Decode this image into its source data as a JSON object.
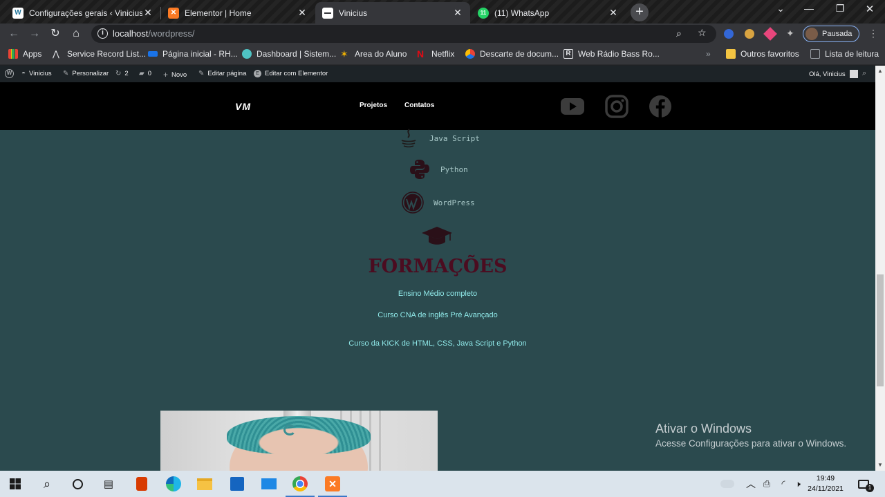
{
  "browser": {
    "tabs": [
      {
        "title": "Configurações gerais ‹ Vinicius —",
        "favicon": "wordpress-icon",
        "active": false
      },
      {
        "title": "Elementor | Home",
        "favicon": "xampp-icon",
        "active": false
      },
      {
        "title": "Vinicius",
        "favicon": "page-icon",
        "active": true
      },
      {
        "title": "(11) WhatsApp",
        "favicon": "whatsapp-icon",
        "active": false
      }
    ],
    "tab_close": "✕",
    "new_tab": "+",
    "address": {
      "host": "localhost",
      "path": "/wordpress/"
    },
    "profile_label": "Pausada",
    "bookmarks": [
      {
        "label": "Apps",
        "icon": "apps-grid-icon"
      },
      {
        "label": "Service Record List...",
        "icon": "service-icon"
      },
      {
        "label": "Página inicial - RH...",
        "icon": "sap-icon"
      },
      {
        "label": "Dashboard | Sistem...",
        "icon": "cloud-icon"
      },
      {
        "label": "Area do Aluno",
        "icon": "star-icon"
      },
      {
        "label": "Netflix",
        "icon": "netflix-icon"
      },
      {
        "label": "Descarte de docum...",
        "icon": "drive-icon"
      },
      {
        "label": "Web Rádio Bass Ro...",
        "icon": "radio-icon"
      }
    ],
    "bookmarks_overflow": "»",
    "other_favorites": "Outros favoritos",
    "reading_list": "Lista de leitura"
  },
  "wp_adminbar": {
    "site": "Vinicius",
    "customize": "Personalizar",
    "updates": "2",
    "comments": "0",
    "new": "Novo",
    "edit_page": "Editar página",
    "edit_elementor": "Editar com Elementor",
    "greeting": "Olá, Vinicius"
  },
  "site": {
    "logo": "VM",
    "menu": [
      "Projetos",
      "Contatos"
    ],
    "social": [
      "youtube-icon",
      "instagram-icon",
      "facebook-icon"
    ],
    "skills": [
      {
        "label": "Java Script",
        "icon": "java-icon"
      },
      {
        "label": "Python",
        "icon": "python-icon"
      },
      {
        "label": "WordPress",
        "icon": "wordpress-icon"
      }
    ],
    "education_title": "FORMAÇÕES",
    "education_items": [
      "Ensino Médio completo",
      "Curso CNA de inglês Pré Avançado",
      "Curso da KICK de HTML, CSS, Java Script e Python"
    ]
  },
  "watermark": {
    "title": "Ativar o Windows",
    "subtitle": "Acesse Configurações para ativar o Windows."
  },
  "taskbar": {
    "time": "19:49",
    "date": "24/11/2021",
    "notification_count": "1"
  },
  "colors": {
    "site_bg": "#2b4a4e",
    "accent_maroon": "#4b0c20",
    "education_text": "#8fe8e8"
  }
}
